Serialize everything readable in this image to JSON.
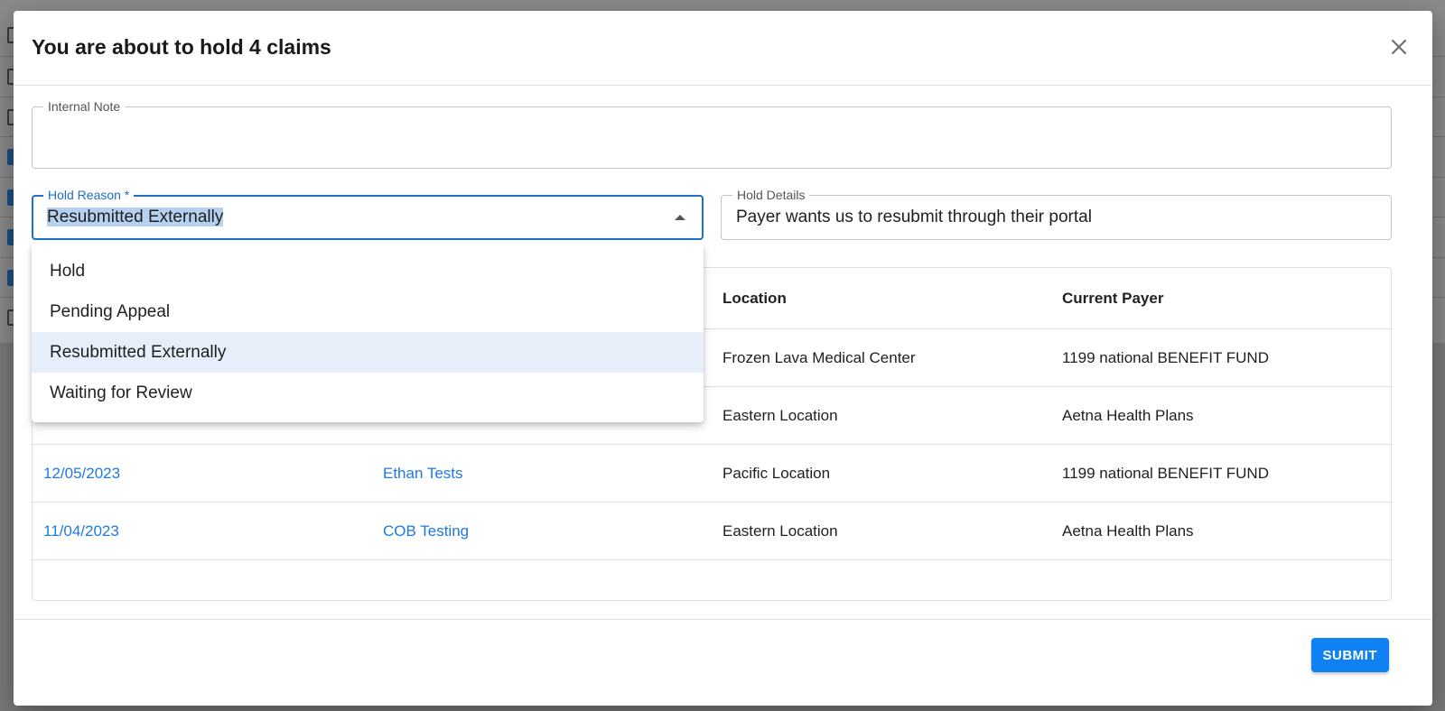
{
  "modal": {
    "title": "You are about to hold 4 claims"
  },
  "internal_note": {
    "label": "Internal Note",
    "value": ""
  },
  "hold_reason": {
    "label": "Hold Reason *",
    "value": "Resubmitted Externally",
    "options": [
      "Hold",
      "Pending Appeal",
      "Resubmitted Externally",
      "Waiting for Review"
    ],
    "active_index": 2
  },
  "hold_details": {
    "label": "Hold Details",
    "value": "Payer wants us to resubmit through their portal"
  },
  "table": {
    "headers": [
      "",
      "",
      "Location",
      "Current Payer"
    ],
    "rows": [
      {
        "date": "",
        "patient": "",
        "location": "Frozen Lava Medical Center",
        "payer": "1199 national BENEFIT FUND"
      },
      {
        "date": "",
        "patient": "",
        "location": "Eastern Location",
        "payer": "Aetna Health Plans"
      },
      {
        "date": "12/05/2023",
        "patient": "Ethan Tests",
        "location": "Pacific Location",
        "payer": "1199 national BENEFIT FUND"
      },
      {
        "date": "11/04/2023",
        "patient": "COB Testing",
        "location": "Eastern Location",
        "payer": "Aetna Health Plans"
      }
    ]
  },
  "footer": {
    "submit_label": "SUBMIT"
  },
  "colors": {
    "accent": "#1f6fc5",
    "link": "#1f7ae0",
    "submit": "#1081f2",
    "active_option": "#e6eefa"
  }
}
